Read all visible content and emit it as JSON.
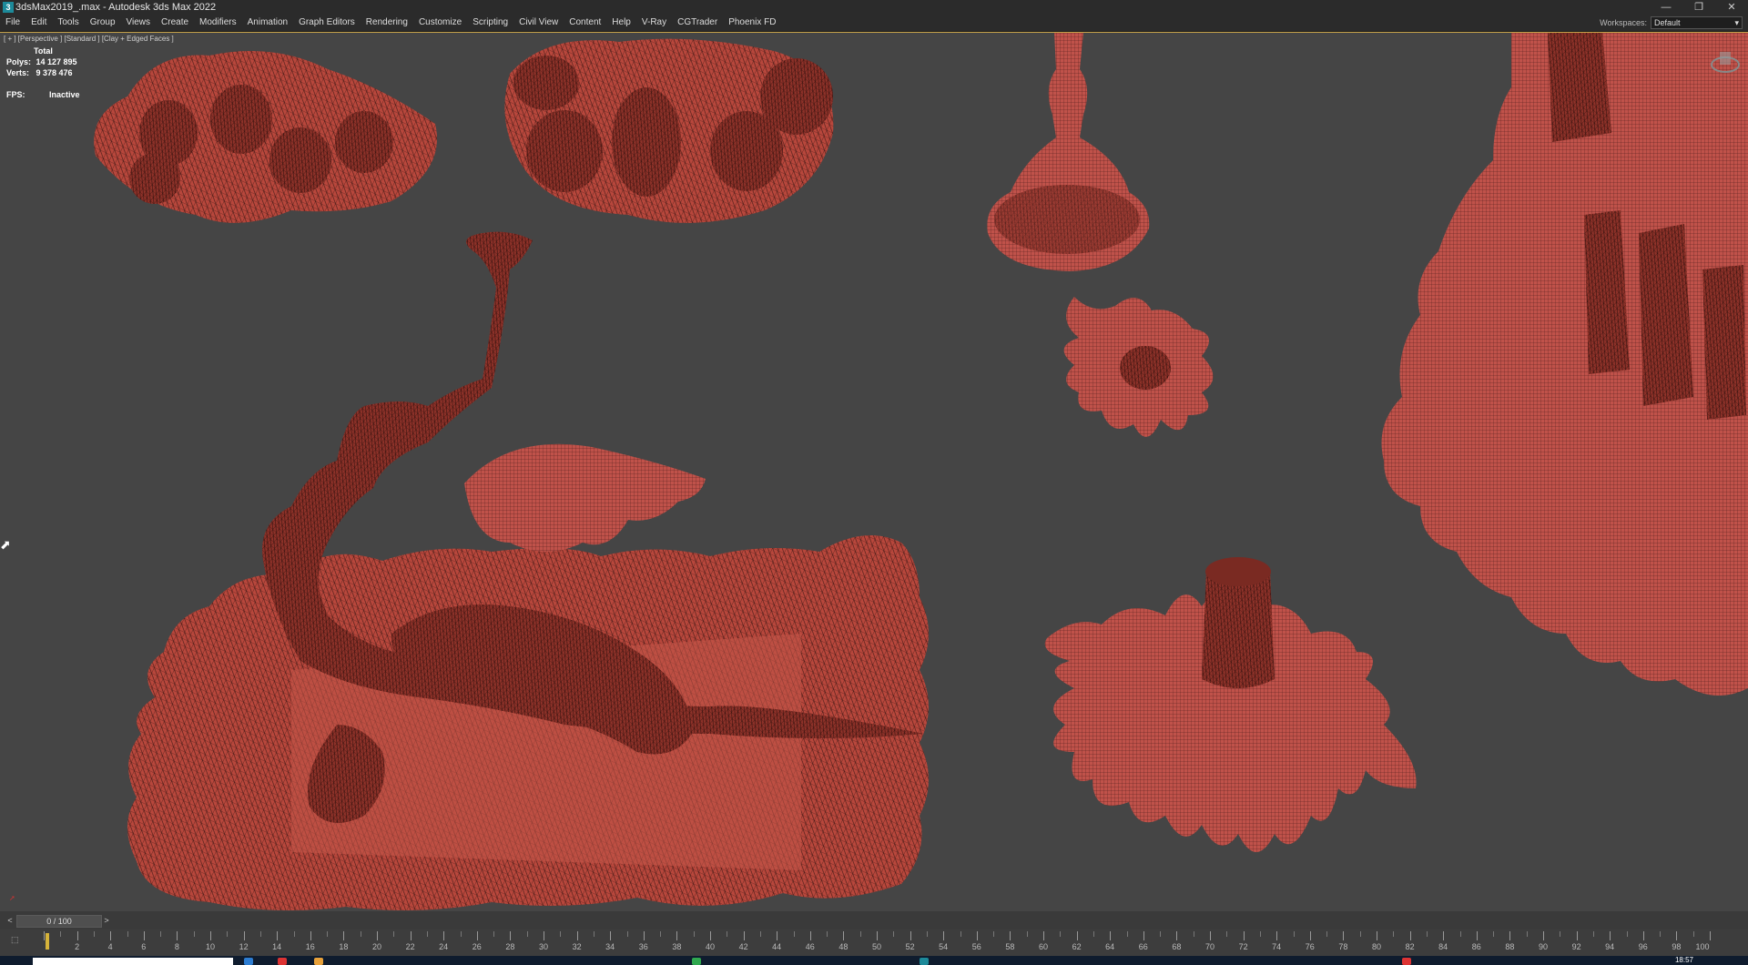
{
  "window": {
    "app_icon": "3ds-max-icon",
    "app_icon_text": "3",
    "title": "3dsMax2019_.max - Autodesk 3ds Max 2022",
    "controls": [
      "minimize-icon",
      "restore-icon",
      "close-icon"
    ]
  },
  "menu": {
    "items": [
      "File",
      "Edit",
      "Tools",
      "Group",
      "Views",
      "Create",
      "Modifiers",
      "Animation",
      "Graph Editors",
      "Rendering",
      "Customize",
      "Scripting",
      "Civil View",
      "Content",
      "Help",
      "V-Ray",
      "CGTrader",
      "Phoenix FD"
    ]
  },
  "workspace": {
    "label": "Workspaces:",
    "value": "Default"
  },
  "viewport": {
    "label": "[ + ] [Perspective ] [Standard ] [Clay + Edged Faces ]",
    "stats_header": "Total",
    "polys_label": "Polys:",
    "polys_value": "14 127 895",
    "verts_label": "Verts:",
    "verts_value": "9 378 476",
    "fps_label": "FPS:",
    "fps_value": "Inactive",
    "mesh_color": "#b8473c",
    "wire_color": "#3a1714",
    "background_color": "#454545"
  },
  "time_slider": {
    "value": "0 / 100",
    "prev_label": "<",
    "next_label": ">"
  },
  "trackbar": {
    "key_button": "⬚",
    "ticks": [
      "2",
      "4",
      "6",
      "8",
      "10",
      "12",
      "14",
      "16",
      "18",
      "20",
      "22",
      "24",
      "26",
      "28",
      "30",
      "32",
      "34",
      "36",
      "38",
      "40",
      "42",
      "44",
      "46",
      "48",
      "50",
      "52",
      "54",
      "56",
      "58",
      "60",
      "62",
      "64",
      "66",
      "68",
      "70",
      "72",
      "74",
      "76",
      "78",
      "80",
      "82",
      "84",
      "86",
      "88",
      "90",
      "92",
      "94",
      "96",
      "98",
      "100"
    ]
  },
  "taskbar": {
    "clock": "18:57"
  }
}
